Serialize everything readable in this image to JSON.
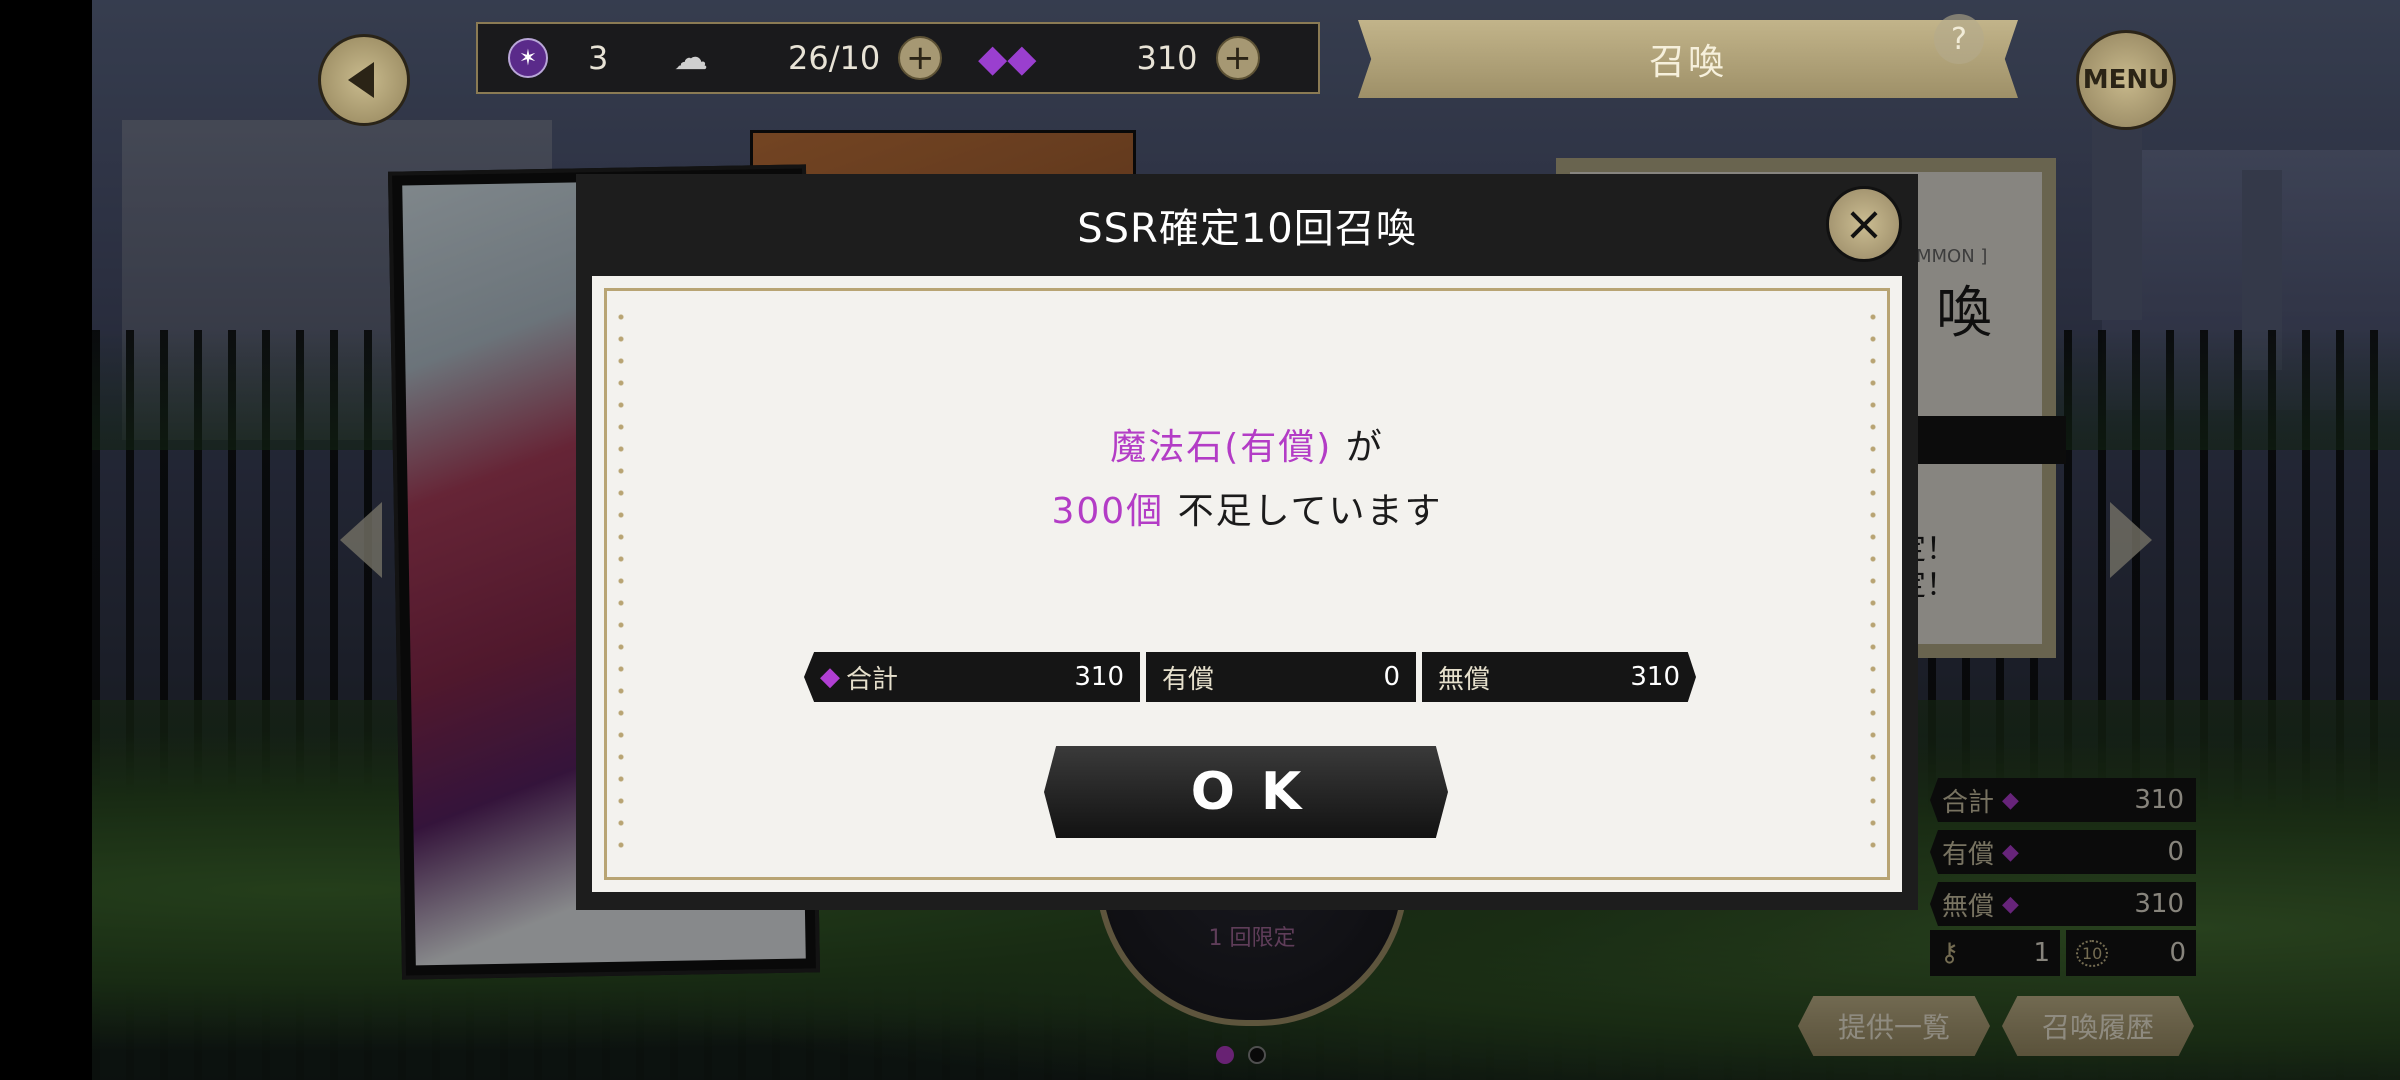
{
  "topbar": {
    "stone_count": "3",
    "stamina": "26/10",
    "gems": "310",
    "summon_title": "召喚",
    "help_label": "?",
    "menu_label": "MENU"
  },
  "right_card": {
    "tag": "MMON ]",
    "title_partial": "喚",
    "line1": "定！",
    "line2": "定！"
  },
  "medal": {
    "label": "1 回限定"
  },
  "stats": {
    "total_label": "合計",
    "total_value": "310",
    "paid_label": "有償",
    "paid_value": "0",
    "free_label": "無償",
    "free_value": "310",
    "key_value": "1",
    "key10_value": "0",
    "key10_badge": "10"
  },
  "buttons": {
    "offer_list": "提供一覧",
    "summon_history": "召喚履歴"
  },
  "modal": {
    "title": "SSR確定10回召喚",
    "close_glyph": "×",
    "msg_stone": "魔法石(有償)",
    "msg_ga": " が",
    "msg_amount": "300個",
    "msg_short": " 不足しています",
    "total_label": "合計",
    "total_value": "310",
    "paid_label": "有償",
    "paid_value": "0",
    "free_label": "無償",
    "free_value": "310",
    "ok_label": "OK"
  },
  "colors": {
    "accent_purple": "#b33cc6",
    "gold": "#b8a473",
    "dark": "#151515"
  }
}
